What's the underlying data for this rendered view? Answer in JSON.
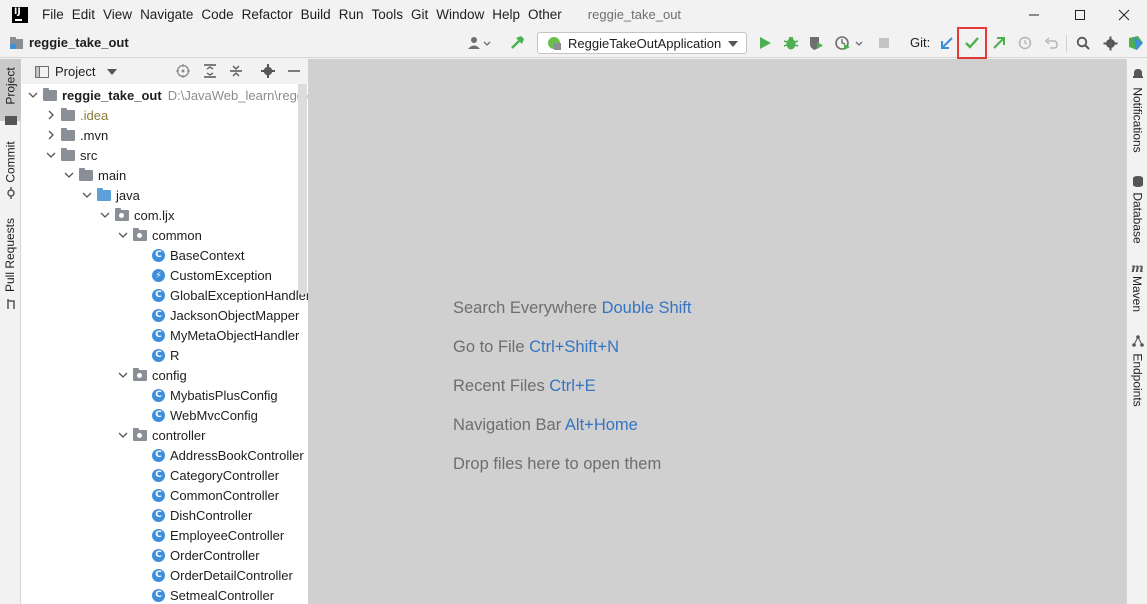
{
  "menubar": {
    "logo_text": "IJ",
    "items": [
      {
        "label": "File"
      },
      {
        "label": "Edit"
      },
      {
        "label": "View"
      },
      {
        "label": "Navigate"
      },
      {
        "label": "Code"
      },
      {
        "label": "Refactor"
      },
      {
        "label": "Build"
      },
      {
        "label": "Run"
      },
      {
        "label": "Tools"
      },
      {
        "label": "Git"
      },
      {
        "label": "Window"
      },
      {
        "label": "Help"
      },
      {
        "label": "Other"
      }
    ],
    "window_title": "reggie_take_out"
  },
  "navbar": {
    "project_name": "reggie_take_out",
    "run_config": "ReggieTakeOutApplication",
    "git_label": "Git:"
  },
  "left_strip": {
    "tabs": [
      "Project",
      "Commit",
      "Pull Requests"
    ]
  },
  "project_panel": {
    "title": "Project",
    "root": {
      "name": "reggie_take_out",
      "path": "D:\\JavaWeb_learn\\reggie_take_out"
    },
    "tree": [
      {
        "label": ".idea"
      },
      {
        "label": ".mvn"
      },
      {
        "label": "src"
      },
      {
        "label": "main"
      },
      {
        "label": "java"
      },
      {
        "label": "com.ljx"
      },
      {
        "label": "common"
      },
      {
        "label": "BaseContext"
      },
      {
        "label": "CustomException"
      },
      {
        "label": "GlobalExceptionHandler"
      },
      {
        "label": "JacksonObjectMapper"
      },
      {
        "label": "MyMetaObjectHandler"
      },
      {
        "label": "R"
      },
      {
        "label": "config"
      },
      {
        "label": "MybatisPlusConfig"
      },
      {
        "label": "WebMvcConfig"
      },
      {
        "label": "controller"
      },
      {
        "label": "AddressBookController"
      },
      {
        "label": "CategoryController"
      },
      {
        "label": "CommonController"
      },
      {
        "label": "DishController"
      },
      {
        "label": "EmployeeController"
      },
      {
        "label": "OrderController"
      },
      {
        "label": "OrderDetailController"
      },
      {
        "label": "SetmealController"
      }
    ]
  },
  "editor": {
    "hints": [
      {
        "text": "Search Everywhere",
        "key": "Double Shift"
      },
      {
        "text": "Go to File",
        "key": "Ctrl+Shift+N"
      },
      {
        "text": "Recent Files",
        "key": "Ctrl+E"
      },
      {
        "text": "Navigation Bar",
        "key": "Alt+Home"
      },
      {
        "text": "Drop files here to open them",
        "key": ""
      }
    ]
  },
  "right_strip": {
    "tabs": [
      "Notifications",
      "Database",
      "Maven",
      "Endpoints"
    ]
  },
  "colors": {
    "accent_blue": "#3574c0",
    "run_green": "#4caf50",
    "highlight_red": "#e53935"
  }
}
